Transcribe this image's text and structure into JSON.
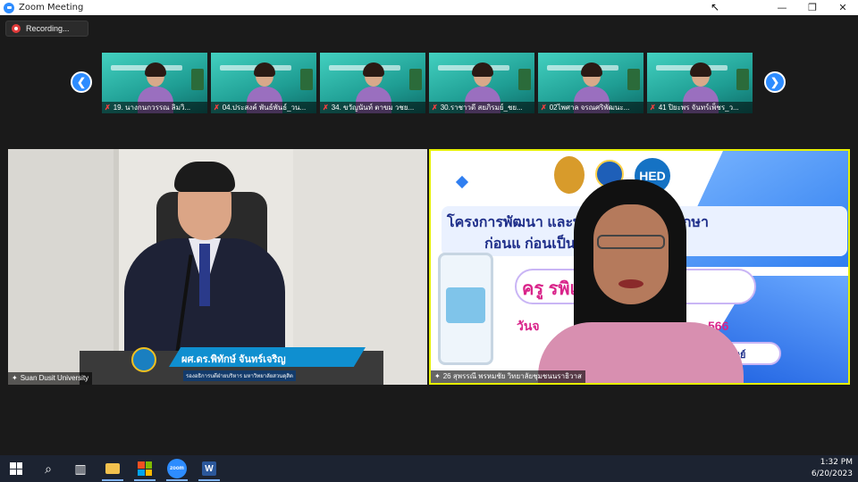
{
  "window": {
    "title": "Zoom Meeting",
    "controls": {
      "minimize": "—",
      "restore": "❐",
      "close": "✕"
    }
  },
  "recording": {
    "label": "Recording..."
  },
  "gallery": {
    "participants": [
      {
        "name": "19. นางกนกวรรณ  ลิมวิ..."
      },
      {
        "name": "04.ประสงค์ พันธ์พันธ์_วน..."
      },
      {
        "name": "34. ขวัญนันท์ ตาขม วชย..."
      },
      {
        "name": "30.ราชาวดี สยภิรมย์_ชย..."
      },
      {
        "name": "02ไพศาล จรณศริพัฒนะ..."
      },
      {
        "name": "41 ปิยะพร จันทร์เพ็ชร_ว..."
      }
    ]
  },
  "speaker_left": {
    "name_tag": "Suan Dusit University",
    "lower_third_title": "ผศ.ดร.พิทักษ์ จันทร์เจริญ",
    "lower_third_subtitle": "รองอธิการบดีฝ่ายบริหาร มหาวิทยาลัยสวนดุสิต"
  },
  "speaker_right": {
    "name_tag": "26 สุพรรณี  พรหมชัย วิทยาลัยชุมชนนราธิวาส",
    "slide": {
      "logo_text": "HED",
      "line1": "โครงการพัฒนา                 และบุคลากรทางการศึกษา",
      "line2": "ก่อนแ                         ก่อนเป็นวิทยฐานะ",
      "pill": "ครู                    รพิเศษ",
      "date_left": "วันจ",
      "date_right": "566",
      "pill2": "มนุษย์"
    }
  },
  "taskbar": {
    "time": "1:32 PM",
    "date": "6/20/2023",
    "zoom_label": "zoom",
    "word_label": "W"
  }
}
